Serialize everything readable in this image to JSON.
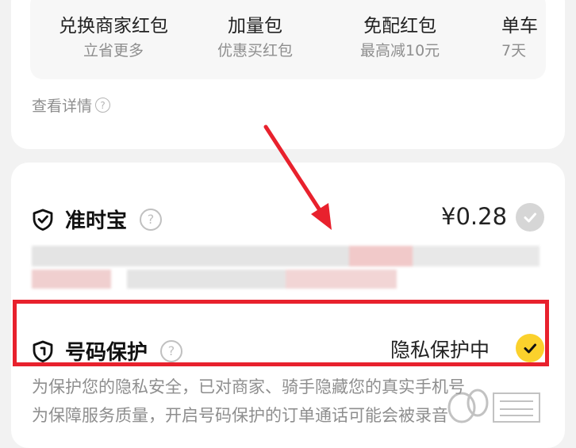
{
  "benefits": [
    {
      "title": "兑换商家红包",
      "subtitle": "立省更多"
    },
    {
      "title": "加量包",
      "subtitle": "优惠买红包"
    },
    {
      "title": "免配红包",
      "subtitle": "最高减10元"
    },
    {
      "title": "单车",
      "subtitle": "7天"
    }
  ],
  "details_link": "查看详情",
  "ontime": {
    "label": "准时宝",
    "price": "¥0.28"
  },
  "number_protection": {
    "label": "号码保护",
    "status": "隐私保护中",
    "desc_line1": "为保护您的隐私安全，已对商家、骑手隐藏您的真实手机号",
    "desc_line2": "为保障服务质量，开启号码保护的订单通话可能会被录音"
  },
  "colors": {
    "highlight": "#e8212d",
    "check_active": "#fbd12c",
    "check_inactive": "#d6d6d6",
    "arrow": "#e8212d"
  }
}
